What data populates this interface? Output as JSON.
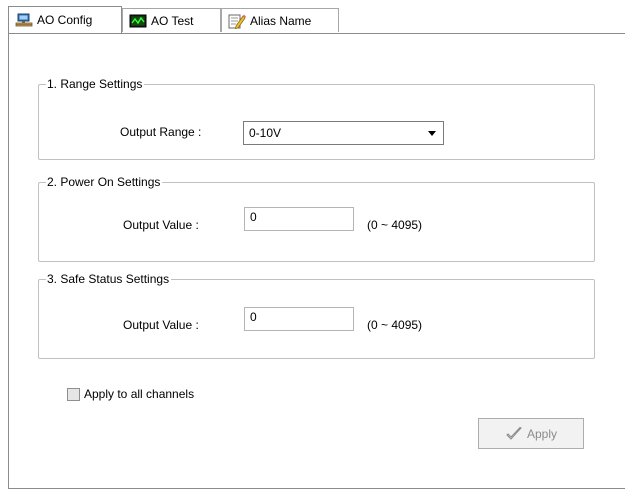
{
  "tabs": [
    {
      "label": "AO Config",
      "icon": "network-config-icon",
      "active": true
    },
    {
      "label": "AO Test",
      "icon": "waveform-test-icon",
      "active": false
    },
    {
      "label": "Alias Name",
      "icon": "edit-pencil-icon",
      "active": false
    }
  ],
  "range_settings": {
    "legend": "1. Range Settings",
    "output_range_label": "Output Range :",
    "output_range_value": "0-10V"
  },
  "power_on_settings": {
    "legend": "2. Power On Settings",
    "output_value_label": "Output Value :",
    "output_value": "0",
    "range_hint": "(0 ~ 4095)"
  },
  "safe_status_settings": {
    "legend": "3. Safe Status Settings",
    "output_value_label": "Output Value :",
    "output_value": "0",
    "range_hint": "(0 ~ 4095)"
  },
  "apply_all": {
    "label": "Apply to all channels",
    "checked": false
  },
  "apply_button": {
    "label": "Apply",
    "icon": "checkmark-icon",
    "enabled": false
  }
}
